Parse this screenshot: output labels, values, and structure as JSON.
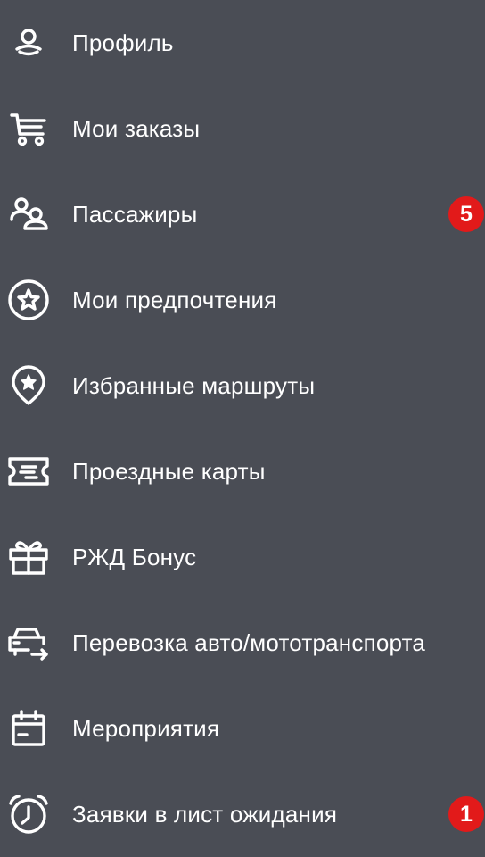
{
  "menu": {
    "items": [
      {
        "label": "Профиль",
        "icon": "profile-icon"
      },
      {
        "label": "Мои заказы",
        "icon": "cart-icon"
      },
      {
        "label": "Пассажиры",
        "icon": "passengers-icon",
        "badge": "5"
      },
      {
        "label": "Мои предпочтения",
        "icon": "star-circle-icon"
      },
      {
        "label": "Избранные маршруты",
        "icon": "star-pin-icon"
      },
      {
        "label": "Проездные карты",
        "icon": "ticket-card-icon"
      },
      {
        "label": "РЖД Бонус",
        "icon": "gift-icon"
      },
      {
        "label": "Перевозка авто/мототранспорта",
        "icon": "car-transport-icon"
      },
      {
        "label": "Мероприятия",
        "icon": "calendar-icon"
      },
      {
        "label": "Заявки в лист ожидания",
        "icon": "alarm-clock-icon",
        "badge": "1"
      }
    ]
  },
  "colors": {
    "background": "#4a4d55",
    "text": "#ffffff",
    "badge": "#e21a1a"
  }
}
